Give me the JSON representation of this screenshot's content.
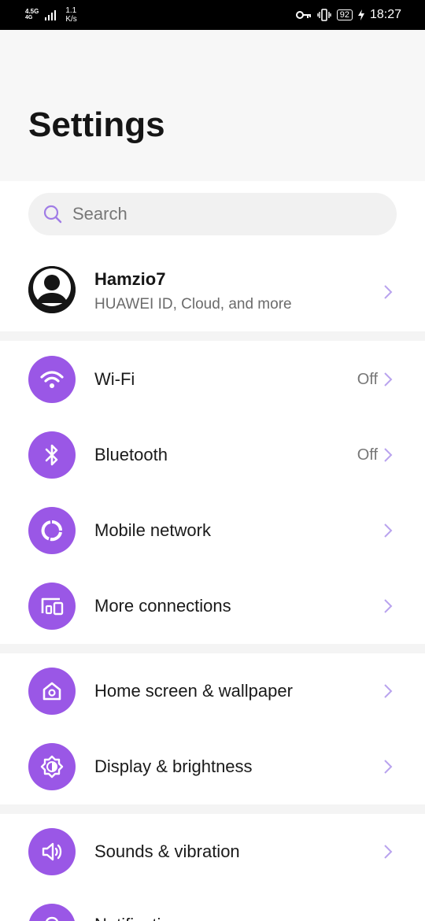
{
  "status_bar": {
    "network_type": "4.5G",
    "network_sub": "4G",
    "speed_value": "1.1",
    "speed_unit": "K/s",
    "battery": "92",
    "time": "18:27",
    "icons": [
      "key-icon",
      "vibrate-icon",
      "battery-icon",
      "charging-icon"
    ]
  },
  "header": {
    "title": "Settings"
  },
  "search": {
    "placeholder": "Search"
  },
  "profile": {
    "name": "Hamzio7",
    "subtitle": "HUAWEI ID, Cloud, and more"
  },
  "settings_items": [
    {
      "label": "Wi-Fi",
      "value": "Off",
      "icon": "wifi-icon"
    },
    {
      "label": "Bluetooth",
      "value": "Off",
      "icon": "bluetooth-icon"
    },
    {
      "label": "Mobile network",
      "value": "",
      "icon": "mobile-network-icon"
    },
    {
      "label": "More connections",
      "value": "",
      "icon": "more-connections-icon"
    },
    {
      "label": "Home screen & wallpaper",
      "value": "",
      "icon": "home-screen-icon"
    },
    {
      "label": "Display & brightness",
      "value": "",
      "icon": "display-brightness-icon"
    },
    {
      "label": "Sounds & vibration",
      "value": "",
      "icon": "sound-icon"
    },
    {
      "label": "Notifications",
      "value": "",
      "icon": "notifications-icon"
    }
  ],
  "colors": {
    "accent": "#9a57e6",
    "header_bg": "#f7f7f7",
    "divider": "#f4f4f4",
    "chevron": "#b9a3ee"
  }
}
